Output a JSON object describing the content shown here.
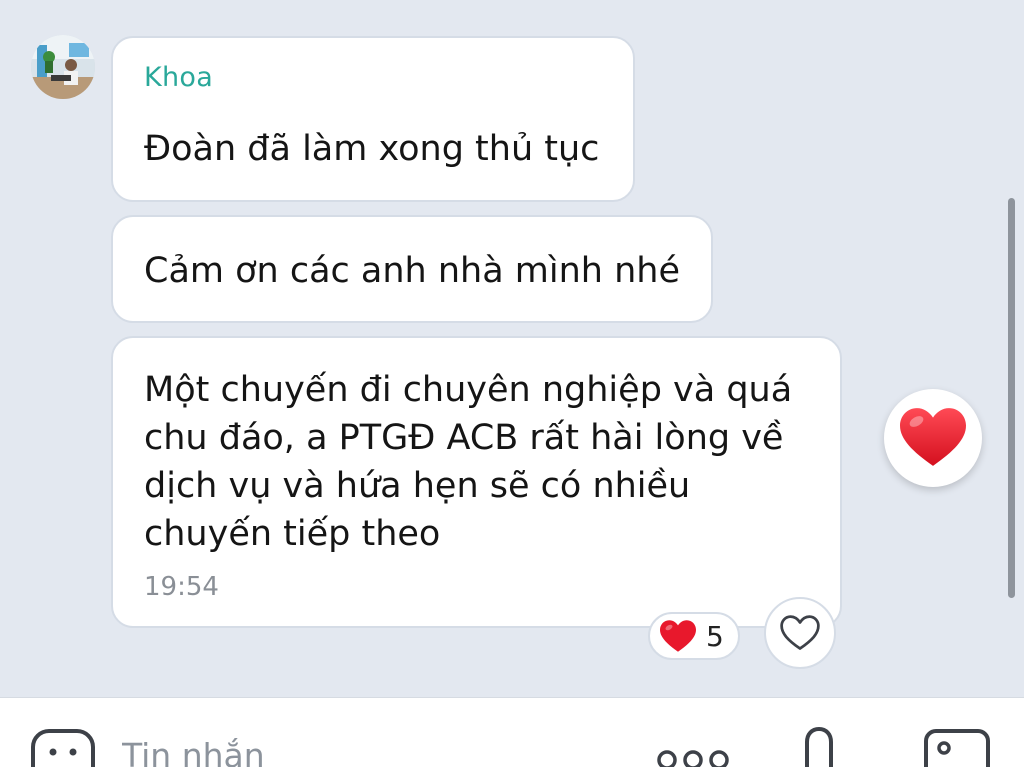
{
  "chat": {
    "sender_name": "Khoa",
    "messages": [
      {
        "text": "Đoàn đã làm xong thủ tục"
      },
      {
        "text": "Cảm ơn các anh nhà mình nhé"
      },
      {
        "text": "Một chuyến đi chuyên nghiệp và quá chu đáo, a PTGĐ ACB rất hài lòng về dịch vụ và hứa hẹn sẽ có nhiều chuyến tiếp theo",
        "time": "19:54"
      }
    ]
  },
  "reactions": {
    "count": "5",
    "quick_reaction": "heart-icon"
  },
  "composer": {
    "placeholder": "Tin nhắn"
  },
  "colors": {
    "background": "#e3e8f0",
    "sender_name": "#2aa89a",
    "heart": "#e8182c"
  }
}
